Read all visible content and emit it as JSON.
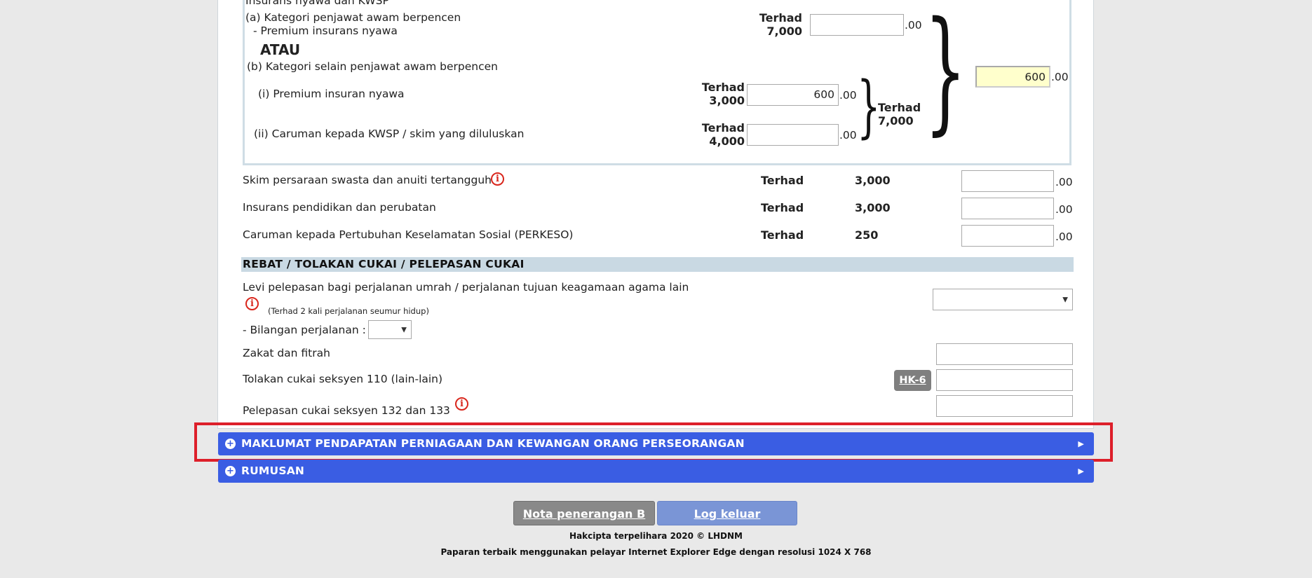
{
  "insurance": {
    "top_label": "Insurans nyawa dan KWSP",
    "a_label": "(a) Kategori penjawat awam berpencen",
    "a_sub": "- Premium insurans nyawa",
    "a_limit_word": "Terhad",
    "a_limit_value": "7,000",
    "atau": "ATAU",
    "b_label": "(b) Kategori selain penjawat awam berpencen",
    "bi_label": "(i) Premium insuran nyawa",
    "bi_limit_word": "Terhad",
    "bi_limit_value": "3,000",
    "bi_value": "600",
    "bii_label": "(ii) Caruman kepada KWSP / skim yang diluluskan",
    "bii_limit_word": "Terhad",
    "bii_limit_value": "4,000",
    "b_total_limit_word": "Terhad",
    "b_total_limit_value": "7,000",
    "total_value": "600",
    "decimal": ".00"
  },
  "rows": [
    {
      "label": "Skim persaraan swasta dan anuiti tertangguh",
      "terhad": "Terhad",
      "limit": "3,000"
    },
    {
      "label": "Insurans pendidikan dan perubatan",
      "terhad": "Terhad",
      "limit": "3,000"
    },
    {
      "label": "Caruman kepada Pertubuhan Keselamatan Sosial (PERKESO)",
      "terhad": "Terhad",
      "limit": "250"
    }
  ],
  "rebate": {
    "heading": "REBAT / TOLAKAN CUKAI / PELEPASAN CUKAI",
    "levi_label": "Levi pelepasan bagi perjalanan umrah / perjalanan tujuan keagamaan agama lain",
    "levi_note": "(Terhad 2 kali perjalanan seumur hidup)",
    "trips_label": "- Bilangan perjalanan :",
    "zakat_label": "Zakat dan fitrah",
    "tolakan_label": "Tolakan cukai seksyen 110 (lain-lain)",
    "hk6_label": "HK-6",
    "pelepasan_label": "Pelepasan cukai seksyen 132 dan 133"
  },
  "sections": {
    "business": "MAKLUMAT PENDAPATAN PERNIAGAAN DAN KEWANGAN ORANG PERSEORANGAN",
    "summary": "RUMUSAN"
  },
  "buttons": {
    "nota": "Nota penerangan B",
    "logout": "Log keluar"
  },
  "footer": {
    "copyright": "Hakcipta terpelihara 2020 © LHDNM",
    "browser_note": "Paparan terbaik menggunakan pelayar Internet Explorer Edge dengan resolusi 1024 X 768"
  },
  "icons": {
    "info": "info-icon",
    "expand": "plus-circle-icon",
    "arrow": "triangle-right-icon"
  },
  "colors": {
    "section_bar": "#3a5de3",
    "highlight": "#dd1f2a",
    "heading_bg": "#c9d9e3",
    "total_field": "#ffffcc"
  }
}
